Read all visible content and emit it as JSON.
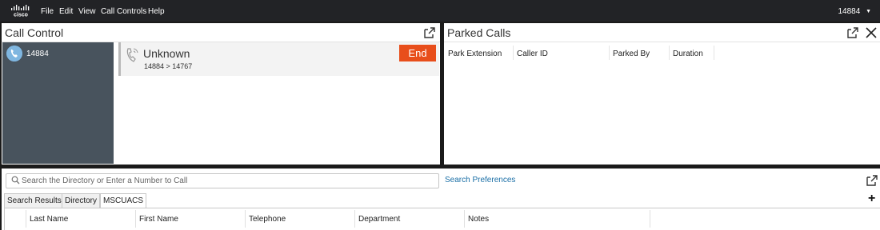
{
  "menubar": {
    "logo_text": "cisco",
    "items": [
      "File",
      "Edit",
      "View",
      "Call Controls",
      "Help"
    ],
    "extension": "14884",
    "extension_caret": "▼"
  },
  "call_control": {
    "title": "Call Control",
    "line": {
      "number": "14884"
    },
    "active_call": {
      "caller": "Unknown",
      "route": "14884 > 14767",
      "end_label": "End"
    }
  },
  "parked_calls": {
    "title": "Parked Calls",
    "columns": [
      "Park Extension",
      "Caller ID",
      "Parked By",
      "Duration"
    ]
  },
  "directory": {
    "search_placeholder": "Search the Directory or Enter a Number to Call",
    "search_preferences": "Search Preferences",
    "tabs": [
      "Search Results",
      "Directory",
      "MSCUACS"
    ],
    "active_tab": "MSCUACS",
    "add_label": "+",
    "columns": [
      "Last Name",
      "First Name",
      "Telephone",
      "Department",
      "Notes"
    ]
  },
  "colors": {
    "end_button": "#e84e1b",
    "line_panel": "#48535d",
    "link": "#1b6fa6"
  }
}
